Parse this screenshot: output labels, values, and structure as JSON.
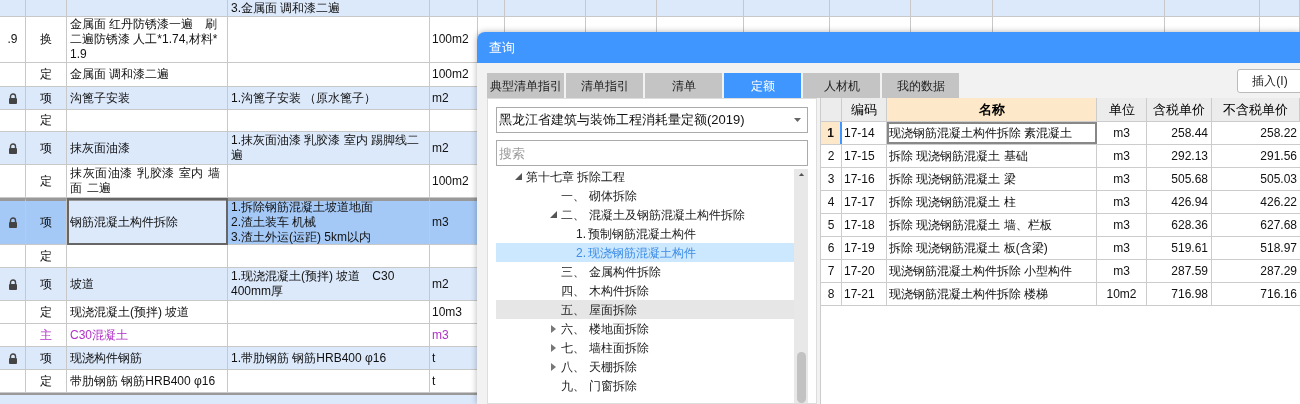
{
  "background_table": {
    "rows": [
      {
        "code": "",
        "locked": false,
        "type": "",
        "kind": "item",
        "name": "",
        "features": "3.金属面 调和漆二遍",
        "unit": "",
        "selected": false
      },
      {
        "code": ".9",
        "locked": false,
        "type": "换",
        "kind": "quota",
        "name": "金属面 红丹防锈漆一遍　刷二遍防锈漆 人工*1.74,材料*1.9",
        "features": "",
        "unit": "100m2",
        "selected": false
      },
      {
        "code": "",
        "locked": false,
        "type": "定",
        "kind": "quota",
        "name": "金属面 调和漆二遍",
        "features": "",
        "unit": "100m2",
        "selected": false
      },
      {
        "code": "",
        "locked": true,
        "type": "项",
        "kind": "item",
        "name": "沟篦子安装",
        "features": "1.沟篦子安装 （原水篦子）",
        "unit": "m2",
        "selected": false
      },
      {
        "code": "",
        "locked": false,
        "type": "定",
        "kind": "quota",
        "name": "",
        "features": "",
        "unit": "",
        "selected": false
      },
      {
        "code": "",
        "locked": true,
        "type": "项",
        "kind": "item",
        "name": "抹灰面油漆",
        "features": "1.抹灰面油漆 乳胶漆 室内 踢脚线二遍",
        "unit": "m2",
        "selected": false
      },
      {
        "code": "",
        "locked": false,
        "type": "定",
        "kind": "quota",
        "name": "抹灰面油漆 乳胶漆 室内 墙面 二遍",
        "features": "",
        "unit": "100m2",
        "selected": false
      },
      {
        "code": "",
        "locked": true,
        "type": "项",
        "kind": "item",
        "name": "钢筋混凝土构件拆除",
        "features": "1.拆除钢筋混凝土坡道地面\n2.渣土装车 机械\n3.渣土外运(运距) 5km以内",
        "unit": "m3",
        "selected": true
      },
      {
        "code": "",
        "locked": false,
        "type": "定",
        "kind": "quota",
        "name": "",
        "features": "",
        "unit": "",
        "selected": false
      },
      {
        "code": "",
        "locked": true,
        "type": "项",
        "kind": "item",
        "name": "坡道",
        "features": "1.现浇混凝土(预拌) 坡道　C30 400mm厚",
        "unit": "m2",
        "selected": false
      },
      {
        "code": "",
        "locked": false,
        "type": "定",
        "kind": "quota",
        "name": "现浇混凝土(预拌) 坡道",
        "features": "",
        "unit": "10m3",
        "selected": false
      },
      {
        "code": "",
        "locked": false,
        "type": "主",
        "kind": "material",
        "name": "C30混凝土",
        "features": "",
        "unit": "m3",
        "selected": false
      },
      {
        "code": "",
        "locked": true,
        "type": "项",
        "kind": "item",
        "name": "现浇构件钢筋",
        "features": "1.带肋钢筋 钢筋HRB400 φ16",
        "unit": "t",
        "selected": false
      },
      {
        "code": "",
        "locked": false,
        "type": "定",
        "kind": "quota",
        "name": "带肋钢筋 钢筋HRB400 φ16",
        "features": "",
        "unit": "t",
        "selected": false
      }
    ]
  },
  "dialog": {
    "title": "查询",
    "tabs": [
      {
        "label": "典型清单指引",
        "selected": false
      },
      {
        "label": "清单指引",
        "selected": false
      },
      {
        "label": "清单",
        "selected": false
      },
      {
        "label": "定额",
        "selected": true
      },
      {
        "label": "人材机",
        "selected": false
      },
      {
        "label": "我的数据",
        "selected": false
      }
    ],
    "insert_button": "插入(I)",
    "library_select": {
      "value": "黑龙江省建筑与装饰工程消耗量定额(2019)"
    },
    "search": {
      "placeholder": "搜索"
    },
    "tree": [
      {
        "label": "第十七章 拆除工程",
        "expanded": true,
        "selected": false,
        "hovered": false,
        "children": [
          {
            "number": "一、",
            "label": "砌体拆除",
            "selected": false,
            "hovered": false
          },
          {
            "number": "二、",
            "label": "混凝土及钢筋混凝土构件拆除",
            "expanded": true,
            "selected": false,
            "hovered": false,
            "children": [
              {
                "number": "1.",
                "label": "预制钢筋混凝土构件",
                "selected": false,
                "hovered": false
              },
              {
                "number": "2.",
                "label": "现浇钢筋混凝土构件",
                "selected": true,
                "hovered": false
              }
            ]
          },
          {
            "number": "三、",
            "label": "金属构件拆除",
            "selected": false,
            "hovered": false
          },
          {
            "number": "四、",
            "label": "木构件拆除",
            "selected": false,
            "hovered": false
          },
          {
            "number": "五、",
            "label": "屋面拆除",
            "selected": false,
            "hovered": true
          },
          {
            "number": "六、",
            "label": "楼地面拆除",
            "expanded": false,
            "selected": false,
            "hovered": false
          },
          {
            "number": "七、",
            "label": "墙柱面拆除",
            "expanded": false,
            "selected": false,
            "hovered": false
          },
          {
            "number": "八、",
            "label": "天棚拆除",
            "expanded": false,
            "selected": false,
            "hovered": false
          },
          {
            "number": "九、",
            "label": "门窗拆除",
            "selected": false,
            "hovered": false
          }
        ]
      }
    ],
    "results": {
      "columns": [
        "编码",
        "名称",
        "单位",
        "含税单价",
        "不含税单价"
      ],
      "rows": [
        {
          "index": "1",
          "code": "17-14",
          "name": "现浇钢筋混凝土构件拆除 素混凝土",
          "unit": "m3",
          "price_with_tax": "258.44",
          "price_without_tax": "258.22",
          "selected": true
        },
        {
          "index": "2",
          "code": "17-15",
          "name": "拆除 现浇钢筋混凝土 基础",
          "unit": "m3",
          "price_with_tax": "292.13",
          "price_without_tax": "291.56",
          "selected": false
        },
        {
          "index": "3",
          "code": "17-16",
          "name": "拆除 现浇钢筋混凝土 梁",
          "unit": "m3",
          "price_with_tax": "505.68",
          "price_without_tax": "505.03",
          "selected": false
        },
        {
          "index": "4",
          "code": "17-17",
          "name": "拆除 现浇钢筋混凝土 柱",
          "unit": "m3",
          "price_with_tax": "426.94",
          "price_without_tax": "426.22",
          "selected": false
        },
        {
          "index": "5",
          "code": "17-18",
          "name": "拆除 现浇钢筋混凝土 墙、栏板",
          "unit": "m3",
          "price_with_tax": "628.36",
          "price_without_tax": "627.68",
          "selected": false
        },
        {
          "index": "6",
          "code": "17-19",
          "name": "拆除 现浇钢筋混凝土 板(含梁)",
          "unit": "m3",
          "price_with_tax": "519.61",
          "price_without_tax": "518.97",
          "selected": false
        },
        {
          "index": "7",
          "code": "17-20",
          "name": "现浇钢筋混凝土构件拆除 小型构件",
          "unit": "m3",
          "price_with_tax": "287.59",
          "price_without_tax": "287.29",
          "selected": false
        },
        {
          "index": "8",
          "code": "17-21",
          "name": "现浇钢筋混凝土构件拆除 楼梯",
          "unit": "10m2",
          "price_with_tax": "716.98",
          "price_without_tax": "716.16",
          "selected": false
        }
      ]
    }
  }
}
